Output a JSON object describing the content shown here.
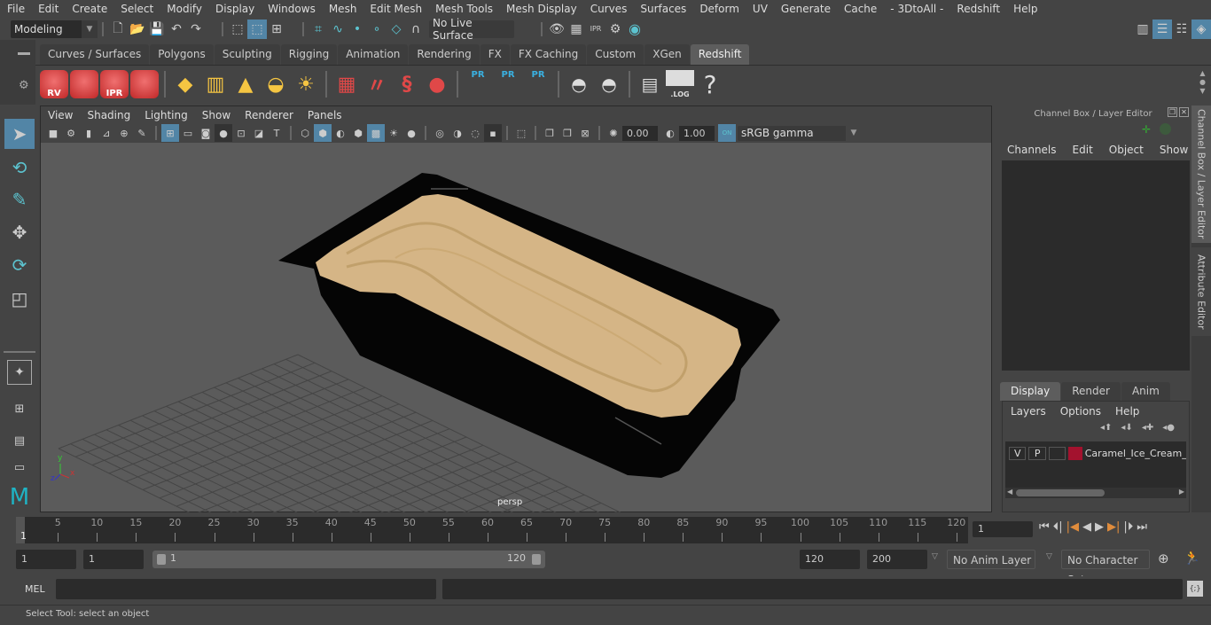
{
  "menubar": {
    "items": [
      "File",
      "Edit",
      "Create",
      "Select",
      "Modify",
      "Display",
      "Windows",
      "Mesh",
      "Edit Mesh",
      "Mesh Tools",
      "Mesh Display",
      "Curves",
      "Surfaces",
      "Deform",
      "UV",
      "Generate",
      "Cache",
      "- 3DtoAll -",
      "Redshift",
      "Help"
    ]
  },
  "statusline": {
    "mode": "Modeling",
    "live_surface": "No Live Surface",
    "icons": [
      "new-scene-icon",
      "open-scene-icon",
      "save-scene-icon",
      "undo-icon",
      "redo-icon",
      "select-hierarchy-icon",
      "select-object-icon",
      "select-component-icon",
      "snap-grid-icon",
      "snap-curve-icon",
      "snap-point-icon",
      "snap-view-plane-icon",
      "snap-surface-icon",
      "make-live-icon",
      "render-view-icon",
      "render-frame-icon",
      "ipr-render-icon",
      "render-settings-icon",
      "hypershade-icon"
    ],
    "right_icons": [
      "modeling-toolkit-icon",
      "attribute-editor-icon",
      "tool-settings-icon",
      "channel-box-icon"
    ]
  },
  "shelf": {
    "tabs": [
      "Curves / Surfaces",
      "Polygons",
      "Sculpting",
      "Rigging",
      "Animation",
      "Rendering",
      "FX",
      "FX Caching",
      "Custom",
      "XGen",
      "Redshift"
    ],
    "active_tab": "Redshift",
    "icons": [
      {
        "name": "rv-icon",
        "label": "RV"
      },
      {
        "name": "render-sequence-icon",
        "label": ""
      },
      {
        "name": "ipr-icon",
        "label": "IPR"
      },
      {
        "name": "rs-settings-icon",
        "label": ""
      },
      {
        "name": "rs-area-light-icon",
        "label": ""
      },
      {
        "name": "rs-portal-light-icon",
        "label": ""
      },
      {
        "name": "rs-spot-light-icon",
        "label": ""
      },
      {
        "name": "rs-dome-light-icon",
        "label": ""
      },
      {
        "name": "rs-sun-sky-icon",
        "label": ""
      },
      {
        "name": "rs-proxy-icon",
        "label": ""
      },
      {
        "name": "rs-hair-icon",
        "label": ""
      },
      {
        "name": "rs-volume-icon",
        "label": ""
      },
      {
        "name": "rs-sphere-icon",
        "label": ""
      },
      {
        "name": "pr-create-icon",
        "label": "PR"
      },
      {
        "name": "pr-export-icon",
        "label": "PR"
      },
      {
        "name": "pr-convert-icon",
        "label": "PR"
      },
      {
        "name": "bake-multiple-icon",
        "label": ""
      },
      {
        "name": "bake-icon",
        "label": ""
      },
      {
        "name": "script-editor-icon",
        "label": ""
      },
      {
        "name": "log-icon",
        "label": ".LOG"
      },
      {
        "name": "help-icon",
        "label": "?"
      }
    ]
  },
  "viewport": {
    "menu": [
      "View",
      "Shading",
      "Lighting",
      "Show",
      "Renderer",
      "Panels"
    ],
    "exposure": "0.00",
    "gamma": "1.00",
    "color_space": "sRGB gamma",
    "color_mgmt_toggle": "ON",
    "camera_label": "persp",
    "axis": {
      "x": "x",
      "y": "y",
      "z": "z"
    },
    "object_colors": {
      "tub": "#050505",
      "ice_cream": "#d5b586"
    }
  },
  "channel_box": {
    "title": "Channel Box / Layer Editor",
    "menu": [
      "Channels",
      "Edit",
      "Object",
      "Show"
    ]
  },
  "layer_editor": {
    "tabs": [
      "Display",
      "Render",
      "Anim"
    ],
    "active_tab": "Display",
    "menu": [
      "Layers",
      "Options",
      "Help"
    ],
    "layers": [
      {
        "v": "V",
        "p": "P",
        "color": "#a3122e",
        "name": "Caramel_Ice_Cream_Tray"
      }
    ]
  },
  "side_tabs": [
    "Channel Box / Layer Editor",
    "Attribute Editor"
  ],
  "timeslider": {
    "ticks": [
      5,
      10,
      15,
      20,
      25,
      30,
      35,
      40,
      45,
      50,
      55,
      60,
      65,
      70,
      75,
      80,
      85,
      90,
      95,
      100,
      105,
      110,
      115,
      120
    ],
    "current_frame_marker": "1",
    "current_frame": "1",
    "range_min": 1,
    "range_max": 120
  },
  "range": {
    "start": "1",
    "playback_start": "1",
    "slider_min": "1",
    "slider_max": "120",
    "playback_end": "120",
    "end": "200",
    "anim_layer": "No Anim Layer",
    "character_set": "No Character Set"
  },
  "command": {
    "language": "MEL",
    "input": "",
    "output": ""
  },
  "help_line": "Select Tool: select an object",
  "colors": {
    "accent": "#5285a6",
    "teal": "#5cc3cf",
    "redshift_red": "#e04848",
    "light_yellow": "#f5c542",
    "playhead_orange": "#e08c3c"
  }
}
